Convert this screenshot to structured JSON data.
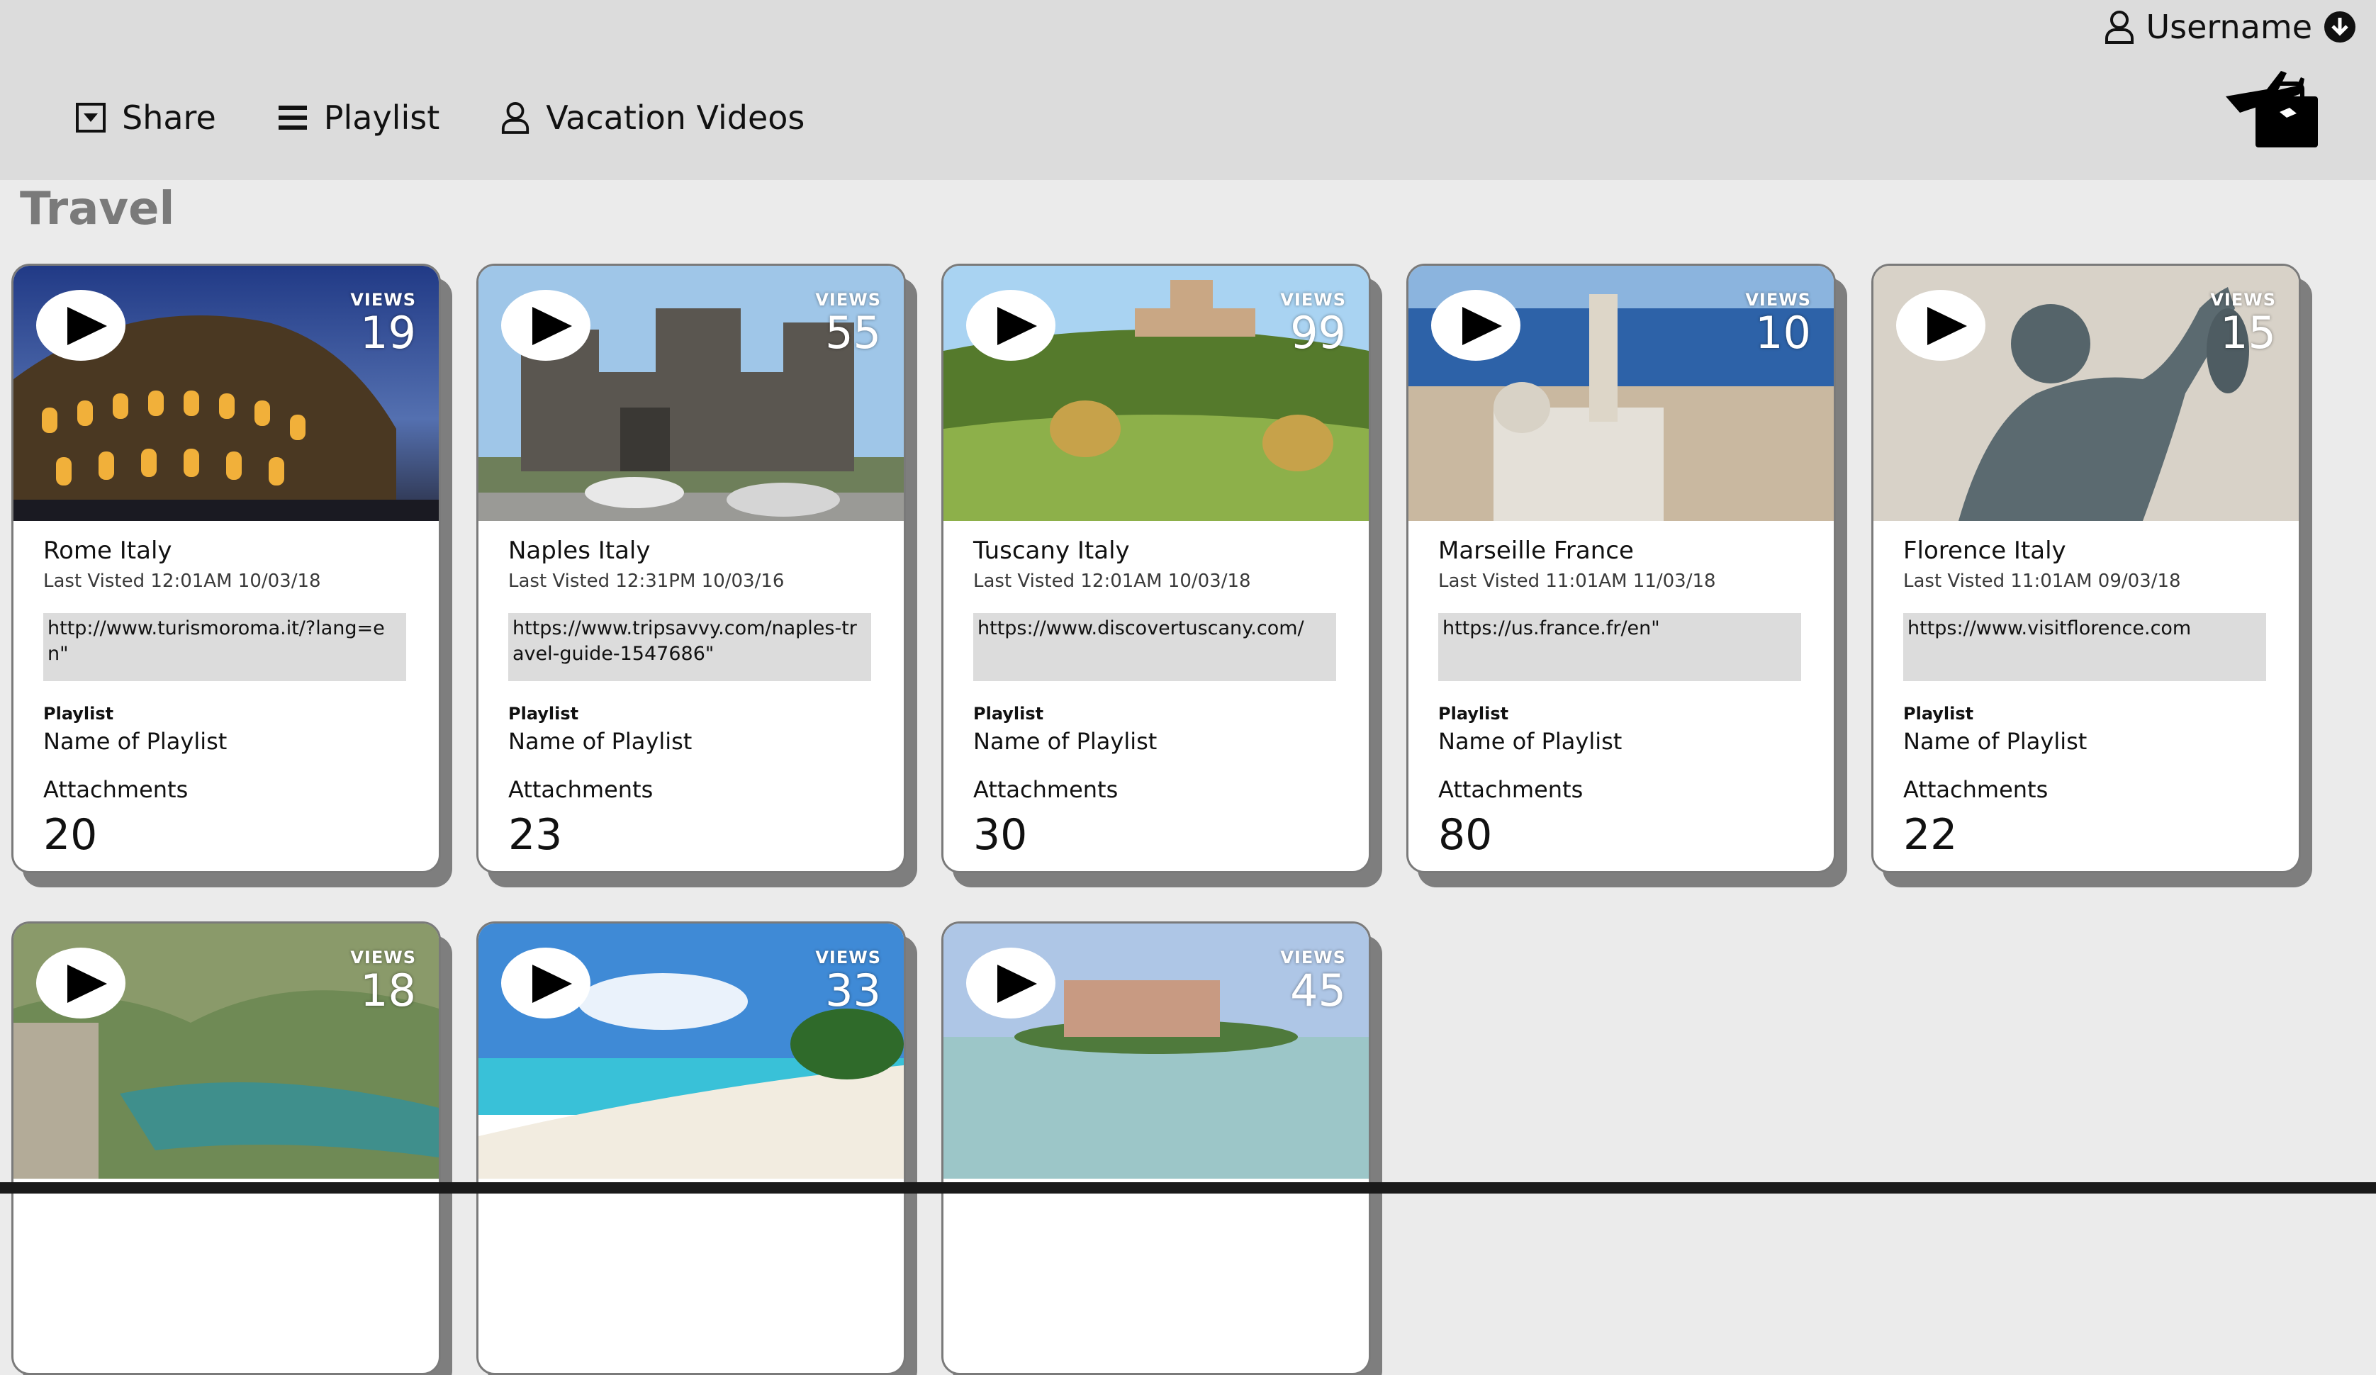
{
  "header": {
    "username": "Username",
    "nav": [
      {
        "label": "Share",
        "icon": "share-box-icon"
      },
      {
        "label": "Playlist",
        "icon": "list-icon"
      },
      {
        "label": "Vacation Videos",
        "icon": "user-icon"
      }
    ],
    "badge_icon": "airplane-luggage-icon"
  },
  "section": {
    "title": "Travel"
  },
  "labels": {
    "views": "VIEWS",
    "playlist": "Playlist",
    "attachments": "Attachments"
  },
  "cards": [
    {
      "name": "Rome Italy",
      "visited": "Last Visted 12:01AM 10/03/18",
      "url": "http://www.turismoroma.it/?lang=en\"",
      "views": "19",
      "playlist": "Name of Playlist",
      "attachments": "20"
    },
    {
      "name": "Naples Italy",
      "visited": "Last Visted 12:31PM 10/03/16",
      "url": "https://www.tripsavvy.com/naples-travel-guide-1547686\"",
      "views": "55",
      "playlist": "Name of Playlist",
      "attachments": "23"
    },
    {
      "name": "Tuscany Italy",
      "visited": "Last Visted 12:01AM 10/03/18",
      "url": "https://www.discovertuscany.com/",
      "views": "99",
      "playlist": "Name of Playlist",
      "attachments": "30"
    },
    {
      "name": "Marseille France",
      "visited": "Last Visted 11:01AM 11/03/18",
      "url": "https://us.france.fr/en\"",
      "views": "10",
      "playlist": "Name of Playlist",
      "attachments": "80"
    },
    {
      "name": "Florence Italy",
      "visited": "Last Visted 11:01AM 09/03/18",
      "url": "https://www.visitflorence.com",
      "views": "15",
      "playlist": "Name of Playlist",
      "attachments": "22"
    },
    {
      "views": "18"
    },
    {
      "views": "33"
    },
    {
      "views": "45"
    }
  ]
}
